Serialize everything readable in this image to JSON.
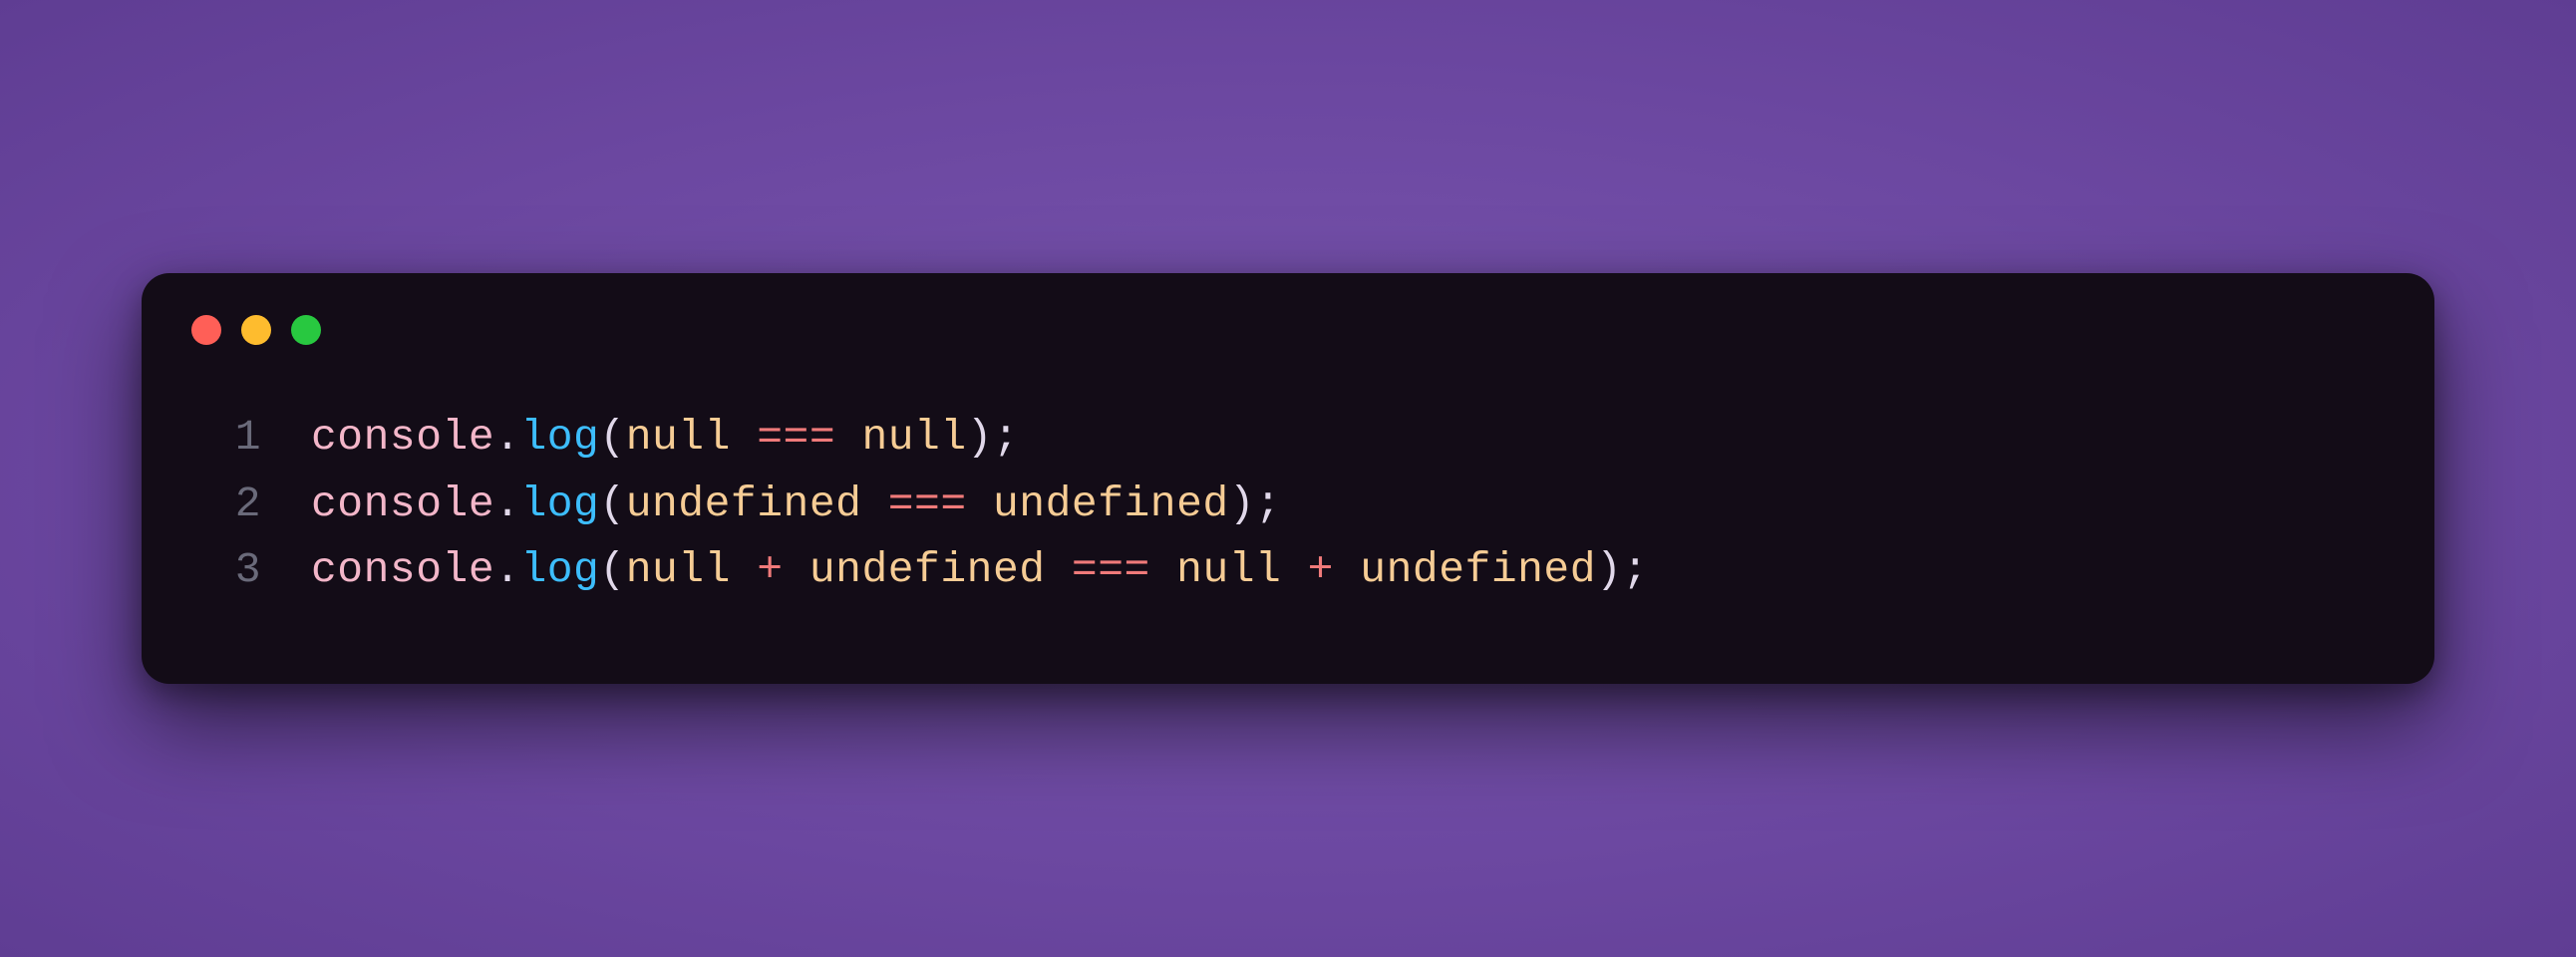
{
  "colors": {
    "close": "#ff5f57",
    "minimize": "#febc2e",
    "maximize": "#28c840"
  },
  "code": {
    "lines": [
      {
        "num": "1",
        "tokens": [
          {
            "cls": "tok-obj",
            "t": "console"
          },
          {
            "cls": "tok-punct",
            "t": "."
          },
          {
            "cls": "tok-method",
            "t": "log"
          },
          {
            "cls": "tok-punct",
            "t": "("
          },
          {
            "cls": "tok-keyword",
            "t": "null"
          },
          {
            "cls": "tok-punct",
            "t": " "
          },
          {
            "cls": "tok-op",
            "t": "==="
          },
          {
            "cls": "tok-punct",
            "t": " "
          },
          {
            "cls": "tok-keyword",
            "t": "null"
          },
          {
            "cls": "tok-punct",
            "t": ");"
          }
        ]
      },
      {
        "num": "2",
        "tokens": [
          {
            "cls": "tok-obj",
            "t": "console"
          },
          {
            "cls": "tok-punct",
            "t": "."
          },
          {
            "cls": "tok-method",
            "t": "log"
          },
          {
            "cls": "tok-punct",
            "t": "("
          },
          {
            "cls": "tok-keyword",
            "t": "undefined"
          },
          {
            "cls": "tok-punct",
            "t": " "
          },
          {
            "cls": "tok-op",
            "t": "==="
          },
          {
            "cls": "tok-punct",
            "t": " "
          },
          {
            "cls": "tok-keyword",
            "t": "undefined"
          },
          {
            "cls": "tok-punct",
            "t": ");"
          }
        ]
      },
      {
        "num": "3",
        "tokens": [
          {
            "cls": "tok-obj",
            "t": "console"
          },
          {
            "cls": "tok-punct",
            "t": "."
          },
          {
            "cls": "tok-method",
            "t": "log"
          },
          {
            "cls": "tok-punct",
            "t": "("
          },
          {
            "cls": "tok-keyword",
            "t": "null"
          },
          {
            "cls": "tok-punct",
            "t": " "
          },
          {
            "cls": "tok-op",
            "t": "+"
          },
          {
            "cls": "tok-punct",
            "t": " "
          },
          {
            "cls": "tok-keyword",
            "t": "undefined"
          },
          {
            "cls": "tok-punct",
            "t": " "
          },
          {
            "cls": "tok-op",
            "t": "==="
          },
          {
            "cls": "tok-punct",
            "t": " "
          },
          {
            "cls": "tok-keyword",
            "t": "null"
          },
          {
            "cls": "tok-punct",
            "t": " "
          },
          {
            "cls": "tok-op",
            "t": "+"
          },
          {
            "cls": "tok-punct",
            "t": " "
          },
          {
            "cls": "tok-keyword",
            "t": "undefined"
          },
          {
            "cls": "tok-punct",
            "t": ");"
          }
        ]
      }
    ]
  }
}
